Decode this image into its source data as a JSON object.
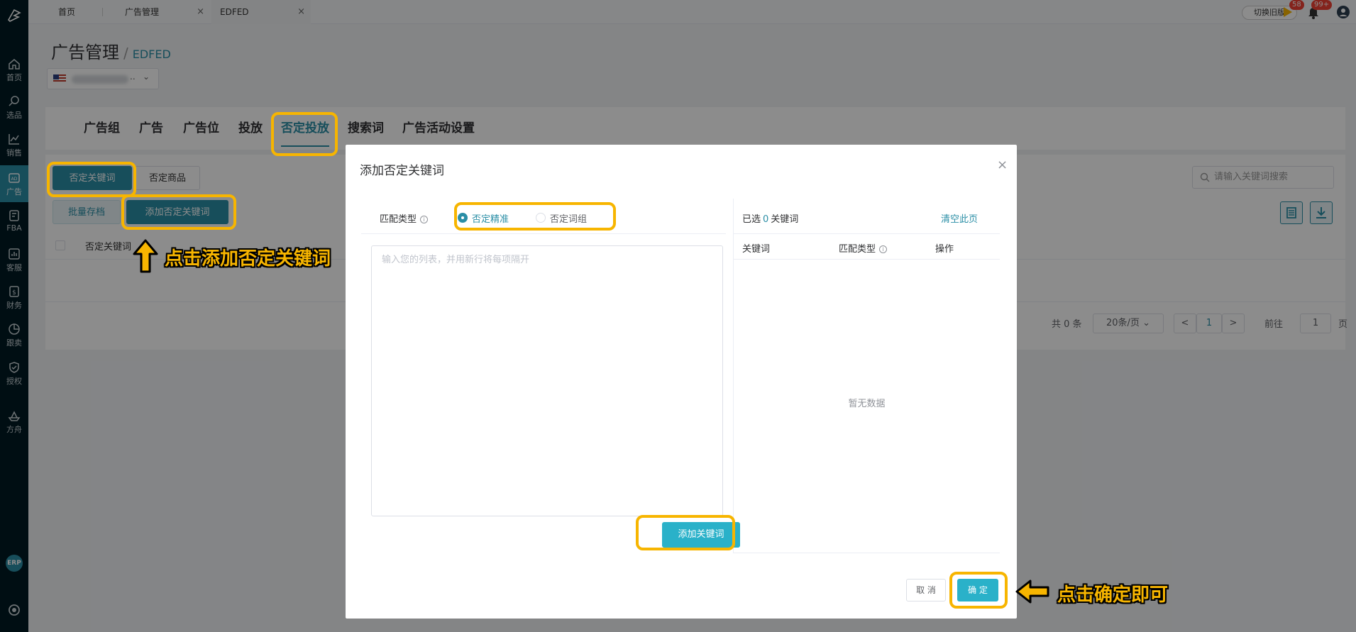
{
  "sidebar": {
    "items": [
      {
        "label": "首页",
        "icon": "home-icon"
      },
      {
        "label": "选品",
        "icon": "search-icon"
      },
      {
        "label": "销售",
        "icon": "chart-line-icon"
      },
      {
        "label": "广告",
        "icon": "ad-icon"
      },
      {
        "label": "FBA",
        "icon": "fba-icon"
      },
      {
        "label": "客服",
        "icon": "service-icon"
      },
      {
        "label": "财务",
        "icon": "dollar-icon"
      },
      {
        "label": "跟卖",
        "icon": "pie-icon"
      },
      {
        "label": "授权",
        "icon": "shield-icon"
      },
      {
        "label": "方舟",
        "icon": "ark-icon"
      }
    ],
    "erp_label": "ERP"
  },
  "topbar": {
    "tabs": [
      {
        "label": "首页"
      },
      {
        "label": "广告管理"
      },
      {
        "label": "EDFED"
      }
    ],
    "old_version": "切换旧版",
    "flag_badge": "58",
    "bell_badge": "99+"
  },
  "page": {
    "title": "广告管理",
    "breadcrumb_sep": "/",
    "subtitle": "EDFED",
    "store_suffix": ".."
  },
  "main_tabs": [
    "广告组",
    "广告",
    "广告位",
    "投放",
    "否定投放",
    "搜索词",
    "广告活动设置"
  ],
  "subtabs": {
    "negative_keyword": "否定关键词",
    "negative_product": "否定商品"
  },
  "actions": {
    "batch_archive": "批量存档",
    "add_negative": "添加否定关键词"
  },
  "search": {
    "placeholder": "请输入关键词搜索"
  },
  "table": {
    "col_keyword": "否定关键词"
  },
  "pagination": {
    "total": "共 0 条",
    "page_size": "20条/页",
    "prev": "<",
    "current": "1",
    "next": ">",
    "goto_prefix": "前往",
    "goto_value": "1",
    "goto_suffix": "页"
  },
  "modal": {
    "title": "添加否定关键词",
    "close": "×",
    "match_type_label": "匹配类型",
    "info": "i",
    "radio_exact": "否定精准",
    "radio_phrase": "否定词组",
    "textarea_placeholder": "输入您的列表，并用新行将每项隔开",
    "add_keyword_btn": "添加关键词",
    "selected_prefix": "已选",
    "selected_count": "0",
    "selected_suffix": "关键词",
    "clear_page": "清空此页",
    "col_keyword": "关键词",
    "col_match_type": "匹配类型",
    "col_action": "操作",
    "no_data": "暂无数据",
    "cancel": "取 消",
    "confirm": "确 定"
  },
  "annotations": {
    "click_add": "点击添加否定关键词",
    "click_confirm": "点击确定即可"
  },
  "colors": {
    "accent": "#2a8ea6",
    "highlight": "#f7b500",
    "sidebar": "#001b24"
  }
}
